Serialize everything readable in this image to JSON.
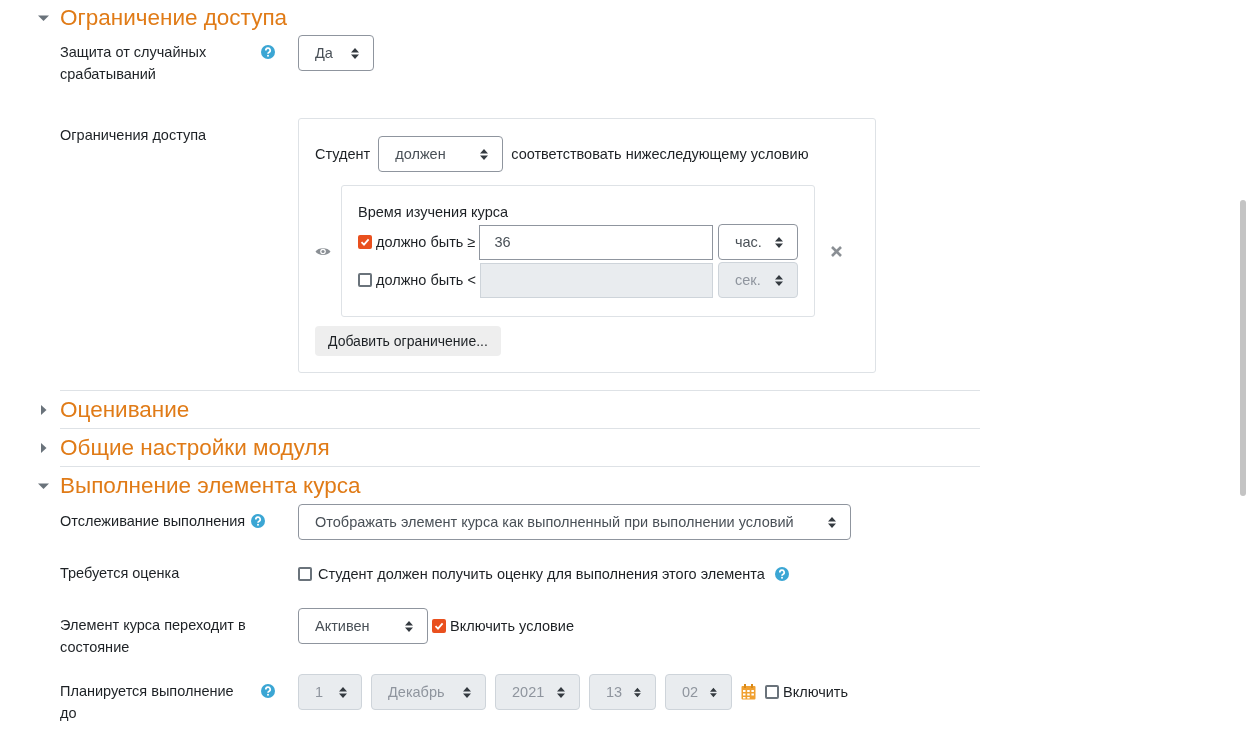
{
  "sections": [
    {
      "title": "Ограничение доступа",
      "expanded": true,
      "fields": [
        {
          "kind": "select",
          "label": "Защита от случайных срабатываний",
          "help": true,
          "value": "Да"
        },
        {
          "kind": "restrictions",
          "label": "Ограничения доступа",
          "prefix": "Студент",
          "must": "должен",
          "suffix": "соответствовать нижеследующему условию",
          "condition": {
            "title": "Время изучения курса",
            "rows": [
              {
                "checked": true,
                "disabled": false,
                "label": "должно быть ≥",
                "value": "36",
                "unit": "час."
              },
              {
                "checked": false,
                "disabled": true,
                "label": "должно быть <",
                "unit": "сек."
              }
            ]
          },
          "add_button": "Добавить ограничение..."
        }
      ]
    },
    {
      "title": "Оценивание",
      "expanded": false
    },
    {
      "title": "Общие настройки модуля",
      "expanded": false
    },
    {
      "title": "Выполнение элемента курса",
      "expanded": true,
      "fields": [
        {
          "kind": "select",
          "label": "Отслеживание выполнения",
          "help": true,
          "value": "Отображать элемент курса как выполненный при выполнении условий"
        },
        {
          "kind": "checkbox",
          "label": "Требуется оценка",
          "checked": false,
          "text": "Студент должен получить оценку для выполнения этого элемента",
          "help": true
        },
        {
          "kind": "select_checkbox",
          "label": "Элемент курса переходит в состояние",
          "value": "Активен",
          "checked": true,
          "text": "Включить условие"
        },
        {
          "kind": "date",
          "label": "Планируется выполнение до",
          "help": true,
          "disabled": true,
          "parts": [
            "1",
            "Декабрь",
            "2021",
            "13",
            "02"
          ],
          "checked": false,
          "text": "Включить"
        }
      ]
    }
  ]
}
